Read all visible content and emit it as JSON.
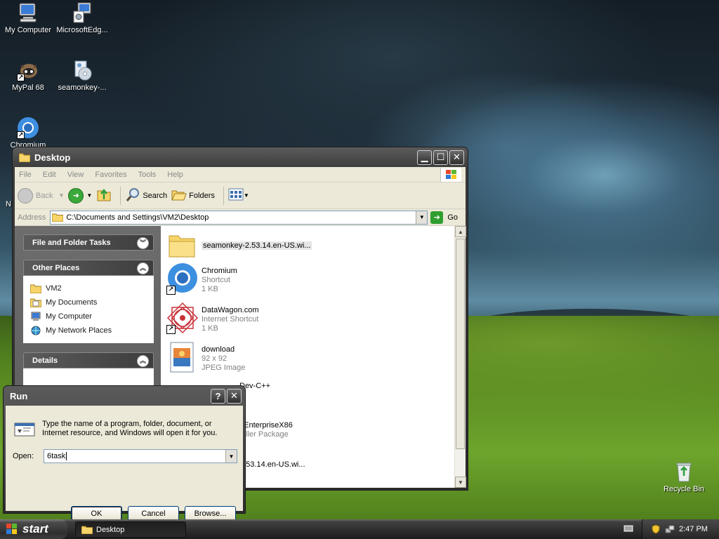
{
  "desktop": {
    "icons": [
      {
        "label": "My Computer"
      },
      {
        "label": "MicrosoftEdg..."
      },
      {
        "label": "MyPal 68"
      },
      {
        "label": "seamonkey-..."
      },
      {
        "label": "Chromium"
      },
      {
        "label": "Recycle Bin"
      }
    ]
  },
  "explorer": {
    "title": "Desktop",
    "menu": [
      "File",
      "Edit",
      "View",
      "Favorites",
      "Tools",
      "Help"
    ],
    "toolbar": {
      "back": "Back",
      "search": "Search",
      "folders": "Folders"
    },
    "address": {
      "label": "Address",
      "path": "C:\\Documents and Settings\\VM2\\Desktop",
      "go": "Go"
    },
    "tasks": {
      "file_folder": "File and Folder Tasks",
      "other_places": "Other Places",
      "places": [
        "VM2",
        "My Documents",
        "My Computer",
        "My Network Places"
      ],
      "details": "Details"
    },
    "files": [
      {
        "name": "seamonkey-2.53.14.en-US.wi...",
        "line2": "",
        "line3": ""
      },
      {
        "name": "Chromium",
        "line2": "Shortcut",
        "line3": "1 KB"
      },
      {
        "name": "DataWagon.com",
        "line2": "Internet Shortcut",
        "line3": "1 KB"
      },
      {
        "name": "download",
        "line2": "92 x 92",
        "line3": "JPEG Image"
      },
      {
        "name": "Dev-C++",
        "line2": "",
        "line3": ""
      },
      {
        "name": "eEnterpriseX86",
        "line2": "taller Package",
        "line3": ""
      },
      {
        "name": "2.53.14.en-US.wi...",
        "line2": "",
        "line3": ""
      }
    ]
  },
  "run": {
    "title": "Run",
    "help": "?",
    "close": "✕",
    "description": "Type the name of a program, folder, document, or Internet resource, and Windows will open it for you.",
    "open_label": "Open:",
    "open_value": "6task",
    "ok": "OK",
    "cancel": "Cancel",
    "browse": "Browse..."
  },
  "taskbar": {
    "start": "start",
    "task": "Desktop",
    "clock": "2:47 PM"
  },
  "colors": {
    "folder": "#f6d469",
    "chromium": "#3d8fe0",
    "selection": "#e6e6e6"
  }
}
